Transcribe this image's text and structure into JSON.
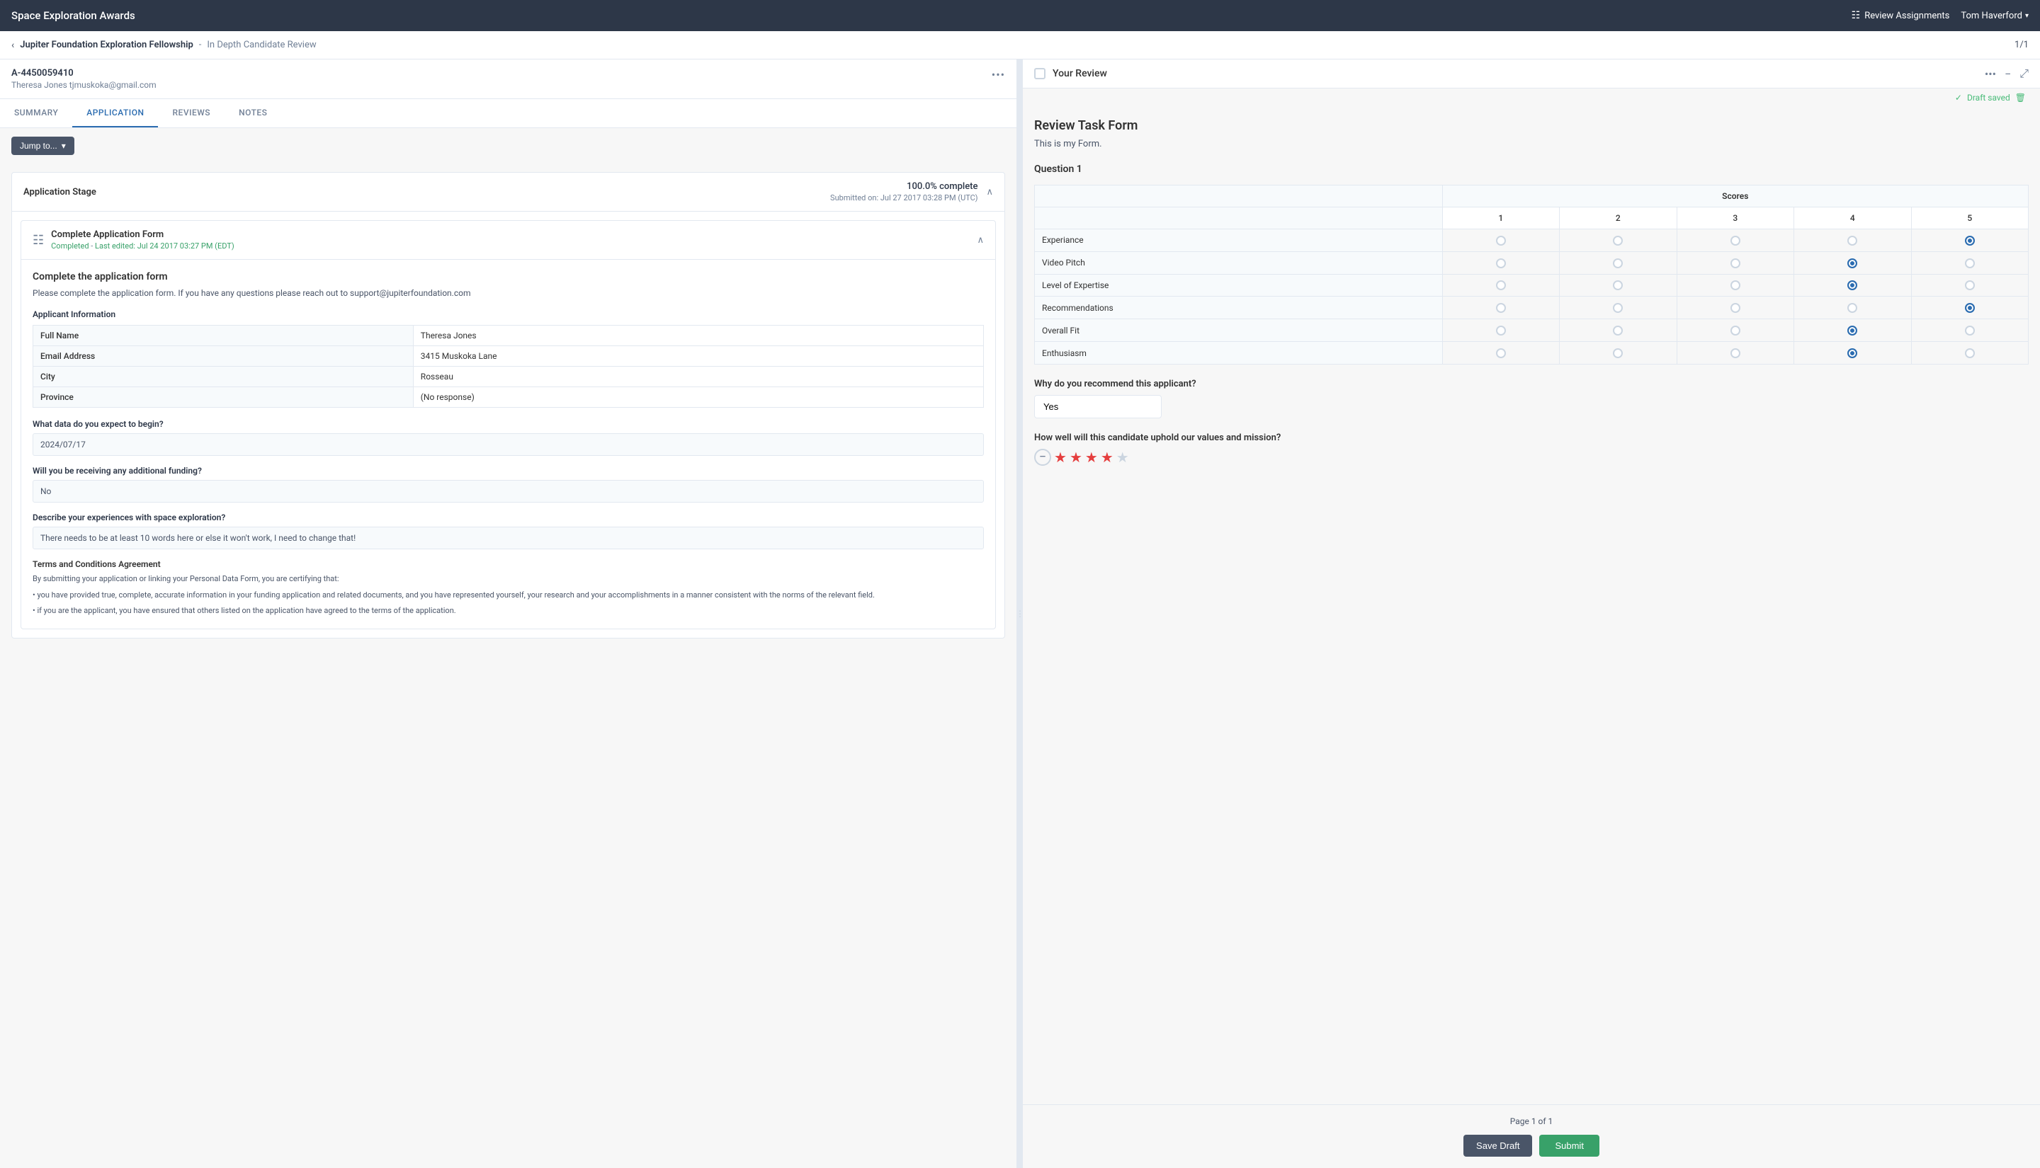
{
  "app": {
    "title": "Space Exploration Awards",
    "nav": {
      "review_assignments": "Review Assignments",
      "user": "Tom Haverford"
    }
  },
  "breadcrumb": {
    "back_label": "‹",
    "program": "Jupiter Foundation Exploration Fellowship",
    "stage": "In Depth Candidate Review",
    "page_counter": "1/1"
  },
  "applicant": {
    "id": "A-4450059410",
    "name": "Theresa Jones",
    "email": "tjmuskoka@gmail.com"
  },
  "tabs": [
    {
      "label": "SUMMARY",
      "active": false
    },
    {
      "label": "APPLICATION",
      "active": true
    },
    {
      "label": "REVIEWS",
      "active": false
    },
    {
      "label": "NOTES",
      "active": false
    }
  ],
  "jump_btn": "Jump to...",
  "application_stage": {
    "title": "Application Stage",
    "completion": "100.0% complete",
    "submitted": "Submitted on: Jul 27 2017 03:28 PM (UTC)"
  },
  "form_card": {
    "title": "Complete Application Form",
    "status_prefix": "Completed",
    "status_suffix": "Last edited: Jul 24 2017 03:27 PM (EDT)",
    "content_title": "Complete the application form",
    "description": "Please complete the application form. If you have any questions please reach out to support@jupiterfoundation.com",
    "applicant_info_label": "Applicant Information",
    "fields": [
      {
        "label": "Full Name",
        "value": "Theresa Jones"
      },
      {
        "label": "Email Address",
        "value": "3415 Muskoka Lane"
      },
      {
        "label": "City",
        "value": "Rosseau"
      },
      {
        "label": "Province",
        "value": "(No response)"
      }
    ],
    "questions": [
      {
        "label": "What data do you expect to begin?",
        "answer": "2024/07/17"
      },
      {
        "label": "Will you be receiving any additional funding?",
        "answer": "No"
      },
      {
        "label": "Describe your experiences with space exploration?",
        "answer": "There needs to be at least 10 words here or else it won't work, I need to change that!"
      }
    ],
    "terms_title": "Terms and Conditions Agreement",
    "terms_intro": "By submitting your application or linking your Personal Data Form, you are certifying that:",
    "terms_bullets": [
      "• you have provided true, complete, accurate information in your funding application and related documents, and you have represented yourself, your research and your accomplishments in a manner consistent with the norms of the relevant field.",
      "• if you are the applicant, you have ensured that others listed on the application have agreed to the terms of the application."
    ]
  },
  "review_panel": {
    "title": "Your Review",
    "draft_saved": "Draft saved",
    "form_title": "Review Task Form",
    "form_desc": "This is my Form.",
    "question1_label": "Question 1",
    "scores_header": "Scores",
    "score_cols": [
      "1",
      "2",
      "3",
      "4",
      "5"
    ],
    "criteria": [
      {
        "label": "Experiance",
        "selected": 5
      },
      {
        "label": "Video Pitch",
        "selected": 4
      },
      {
        "label": "Level of Expertise",
        "selected": 4
      },
      {
        "label": "Recommendations",
        "selected": 5
      },
      {
        "label": "Overall Fit",
        "selected": 4
      },
      {
        "label": "Enthusiasm",
        "selected": 4
      }
    ],
    "recommend_label": "Why do you recommend this applicant?",
    "recommend_value": "Yes",
    "values_label": "How well will this candidate uphold our values and mission?",
    "stars": 5,
    "stars_filled": 4,
    "page_info": "Page 1 of 1",
    "btn_save_draft": "Save Draft",
    "btn_submit": "Submit"
  }
}
